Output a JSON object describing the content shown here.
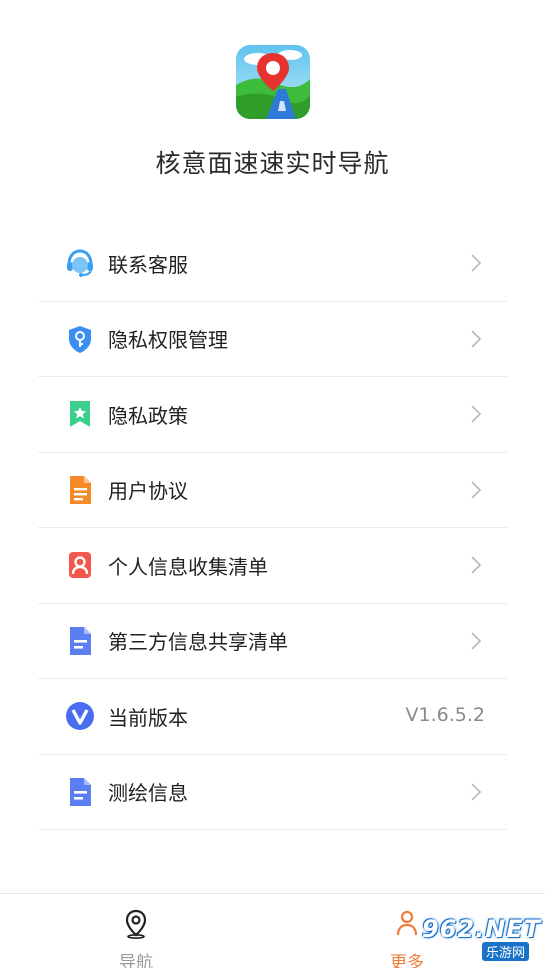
{
  "app": {
    "title": "核意面速速实时导航"
  },
  "menu": [
    {
      "label": "联系客服",
      "icon": "headset-icon"
    },
    {
      "label": "隐私权限管理",
      "icon": "shield-key-icon"
    },
    {
      "label": "隐私政策",
      "icon": "bookmark-star-icon"
    },
    {
      "label": "用户协议",
      "icon": "document-icon"
    },
    {
      "label": "个人信息收集清单",
      "icon": "person-card-icon"
    },
    {
      "label": "第三方信息共享清单",
      "icon": "file-list-icon"
    },
    {
      "label": "当前版本",
      "icon": "version-v-icon",
      "value": "V1.6.5.2"
    },
    {
      "label": "测绘信息",
      "icon": "file-list-icon"
    }
  ],
  "bottom_nav": {
    "items": [
      {
        "label": "导航",
        "icon": "location-pin-icon",
        "active": false
      },
      {
        "label": "更多",
        "icon": "more-person-icon",
        "active": true
      }
    ]
  },
  "watermark": {
    "main": "962.NET",
    "sub": "乐游网"
  },
  "colors": {
    "active_tab": "#f07c3a",
    "inactive_tab": "#9a9a9a",
    "watermark_blue": "#1a73c9"
  }
}
